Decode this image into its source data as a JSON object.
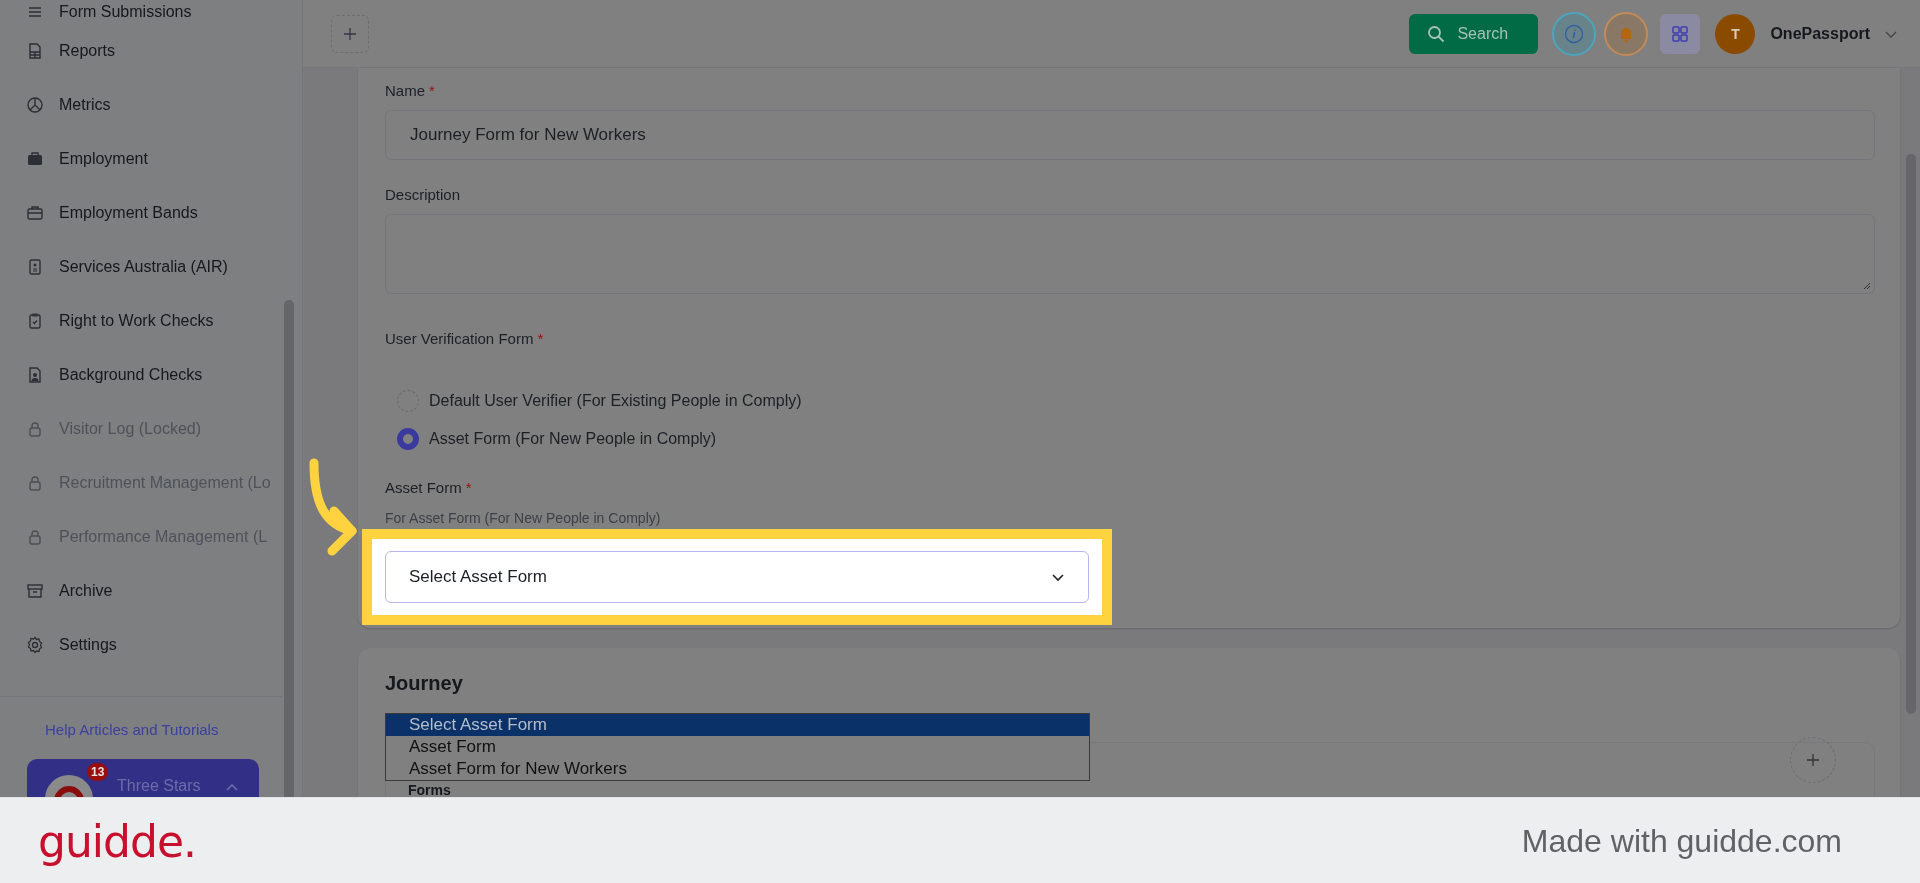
{
  "sidebar": {
    "items": [
      {
        "label": "Form Submissions",
        "locked": false
      },
      {
        "label": "Reports",
        "locked": false
      },
      {
        "label": "Metrics",
        "locked": false
      },
      {
        "label": "Employment",
        "locked": false
      },
      {
        "label": "Employment Bands",
        "locked": false
      },
      {
        "label": "Services Australia (AIR)",
        "locked": false
      },
      {
        "label": "Right to Work Checks",
        "locked": false
      },
      {
        "label": "Background Checks",
        "locked": false
      },
      {
        "label": "Visitor Log (Locked)",
        "locked": true
      },
      {
        "label": "Recruitment Management (Lo",
        "locked": true
      },
      {
        "label": "Performance Management (L",
        "locked": true
      },
      {
        "label": "Archive",
        "locked": false
      },
      {
        "label": "Settings",
        "locked": false
      }
    ],
    "help_link": "Help Articles and Tutorials",
    "account": {
      "name": "Three Stars",
      "badge": "13"
    }
  },
  "topbar": {
    "search": "Search",
    "avatar": "T",
    "user": "OnePassport"
  },
  "form": {
    "name": {
      "label": "Name",
      "marker": "*",
      "value": "Journey Form for New Workers"
    },
    "description": {
      "label": "Description"
    },
    "verification": {
      "label": "User Verification Form",
      "marker": "*",
      "options": [
        {
          "label": "Default User Verifier (For Existing People in Comply)",
          "selected": false
        },
        {
          "label": "Asset Form (For New People in Comply)",
          "selected": true
        }
      ]
    },
    "asset_form": {
      "label": "Asset Form",
      "marker": "*",
      "hint": "For Asset Form (For New People in Comply)",
      "value": "Select Asset Form",
      "options": [
        {
          "label": "Select Asset Form",
          "selected": true
        },
        {
          "label": "Asset Form",
          "selected": false
        },
        {
          "label": "Asset Form for New Workers",
          "selected": false
        }
      ]
    }
  },
  "journey": {
    "title": "Journey",
    "forms_label": "Forms"
  },
  "footer": {
    "logo": "guidde.",
    "credit": "Made with guidde.com"
  }
}
